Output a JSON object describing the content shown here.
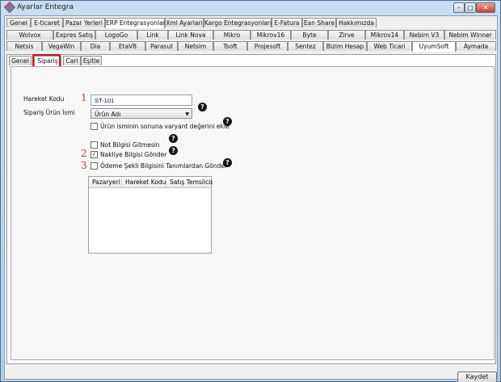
{
  "window": {
    "title": "Ayarlar Entegra"
  },
  "top_tabs": [
    "Genel",
    "E-ticaret",
    "Pazar Yerleri",
    "ERP Entegrasyonları",
    "Xml Ayarları",
    "Kargo Entegrasyonları",
    "E-Fatura",
    "Ean Share",
    "Hakkımızda"
  ],
  "erp_tabs_row1": [
    "Wolvox",
    "Expres Satış",
    "LogoGo",
    "Link",
    "Link Nova",
    "Mikro",
    "Mikrov16",
    "Byte",
    "Zirve",
    "Mikrov14",
    "Nebim V3",
    "Nebim Winner"
  ],
  "erp_tabs_row2": [
    "Netsis",
    "VegaWin",
    "Dia",
    "EtaV8",
    "Parasut",
    "Netsim",
    "Tsoft",
    "Projesoft",
    "Sentez",
    "Bizim Hesap",
    "Web Ticari",
    "UyumSoft",
    "Aymada"
  ],
  "sub_tabs": [
    "Genel",
    "Sipariş",
    "Cari",
    "Eşitle"
  ],
  "form": {
    "hareket_kodu_label": "Hareket Kodu",
    "hareket_kodu_value": "ST-101",
    "siparis_urun_ismi_label": "Sipariş Ürün İsmi",
    "siparis_urun_ismi_value": "Ürün Adı",
    "varyant_label": "Ürün isminin sonuna varyant değerini ekle",
    "not_bilgisi_label": "Not Bilgisi Gitmesin",
    "nakliye_label": "Nakliye Bilgisi Gönder",
    "odeme_label": "Ödeme Şekli Bilgisini Tanımlardan Gönder",
    "help_glyph": "?"
  },
  "markers": [
    "1",
    "2",
    "3"
  ],
  "grid": {
    "columns": [
      "Pazaryeri",
      "Hareket Kodu",
      "Satış Temsilcisi K"
    ]
  },
  "footer": {
    "save_label": "Kaydet"
  },
  "window_buttons": {
    "min": "–",
    "max": "□",
    "close": "✕"
  },
  "colors": {
    "accent_red": "#e01010",
    "marker_red": "#c23b2a",
    "frame_blue": "#b4cfea"
  },
  "icons": [
    "app-icon",
    "help-icon",
    "check-icon",
    "dropdown-arrow-icon"
  ]
}
